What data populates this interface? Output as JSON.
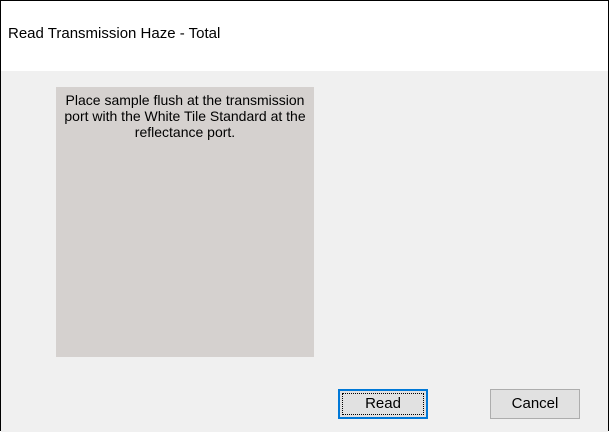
{
  "window": {
    "title": "Read Transmission Haze - Total"
  },
  "panel": {
    "instruction": "Place sample flush at the transmission port with the White Tile Standard at the reflectance port."
  },
  "buttons": {
    "read_label": "Read",
    "cancel_label": "Cancel"
  },
  "colors": {
    "panel_background": "#d5d1cf",
    "dialog_background": "#f0f0f0",
    "default_button_border": "#0078d7"
  }
}
